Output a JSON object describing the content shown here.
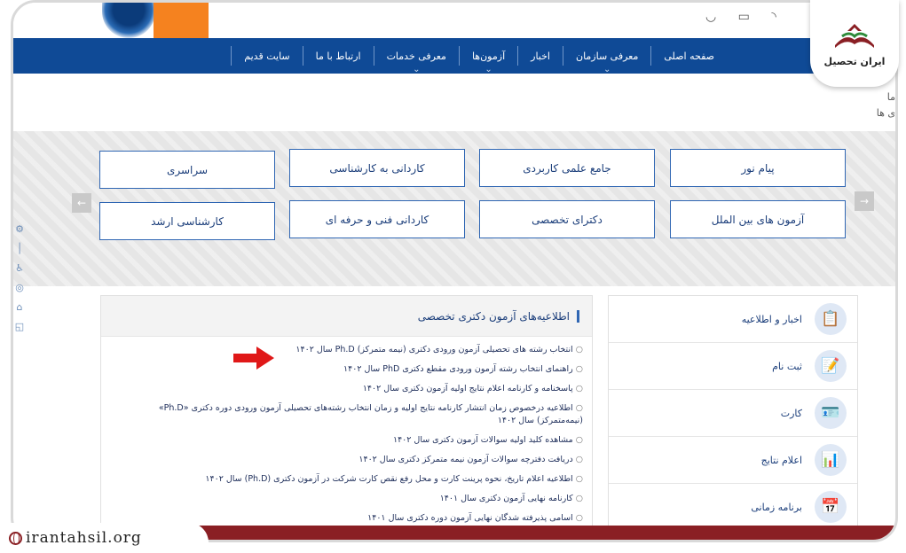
{
  "nav": {
    "items": [
      {
        "label": "صفحه اصلی",
        "caret": false
      },
      {
        "label": "معرفی سازمان",
        "caret": true
      },
      {
        "label": "اخبار",
        "caret": false
      },
      {
        "label": "آزمون‌ها",
        "caret": true
      },
      {
        "label": "معرفی خدمات",
        "caret": true
      },
      {
        "label": "ارتباط با ما",
        "caret": false
      },
      {
        "label": "سایت قدیم",
        "caret": false
      }
    ]
  },
  "crumb": {
    "line1": "ما",
    "line2": "ی ها"
  },
  "categories": {
    "row1": [
      "پیام نور",
      "جامع علمی کاربردی",
      "کاردانی به کارشناسی",
      "سراسری"
    ],
    "row2": [
      "آزمون های بین الملل",
      "دکترای تخصصی",
      "کاردانی فنی و حرفه ای",
      "کارشناسی ارشد"
    ],
    "prev_arrow": "←",
    "next_arrow": "→"
  },
  "announcements": {
    "title": "اطلاعیه‌های آزمون دکتری تخصصی",
    "items": [
      "انتخاب رشته های تحصیلی آزمون ورودی دکتری (نیمه متمرکز) Ph.D سال ۱۴۰۲",
      "راهنمای انتخاب رشته آزمون ورودی مقطع دکتری PhD سال ۱۴۰۲",
      "پاسخنامه و کارنامه اعلام نتایج اولیه آزمون دکتری سال ۱۴۰۲",
      "اطلاعیه درخصوص زمان انتشار کارنامه نتایج اولیه و زمان انتخاب رشته‌های تحصیلی آزمون ورودی دوره دکتری «Ph.D» (نیمه‌متمرکز) سال ۱۴۰۲",
      "مشاهده کلید اولیه سوالات آزمون دکتری سال ۱۴۰۲",
      "دریافت دفترچه سوالات آزمون نیمه متمرکز دکتری سال ۱۴۰۲",
      "اطلاعیه اعلام تاریخ، نحوه پرینت کارت و محل رفع نقص کارت شرکت در آزمون دکتری (Ph.D) سال ۱۴۰۲",
      "کارنامه نهایی آزمون دکتری سال ۱۴۰۱",
      "اسامی پذیرفته شدگان نهایی آزمون دوره دکتری سال ۱۴۰۱"
    ]
  },
  "side_menu": {
    "items": [
      {
        "label": "اخبار و اطلاعیه",
        "icon": "📋",
        "name": "news"
      },
      {
        "label": "ثبت نام",
        "icon": "📝",
        "name": "registration"
      },
      {
        "label": "کارت",
        "icon": "🪪",
        "name": "card"
      },
      {
        "label": "اعلام نتایج",
        "icon": "📊",
        "name": "results"
      },
      {
        "label": "برنامه زمانی",
        "icon": "📅",
        "name": "schedule"
      }
    ]
  },
  "brand": {
    "name": "ایران تحصیل"
  },
  "footer": {
    "url": "irantahsil.org"
  },
  "colors": {
    "nav": "#0f4a96",
    "accent": "#2f66b3",
    "brand_red": "#8a1f24",
    "orange": "#f5821f"
  }
}
